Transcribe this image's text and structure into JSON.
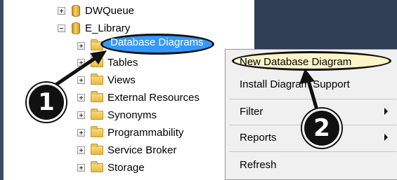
{
  "tree": {
    "items": [
      {
        "label": "DWQueue",
        "type": "database",
        "expander": "plus"
      },
      {
        "label": "E_Library",
        "type": "database",
        "expander": "minus"
      },
      {
        "label": "Database Diagrams",
        "type": "folder",
        "expander": "plus",
        "selected": true
      },
      {
        "label": "Tables",
        "type": "folder",
        "expander": "plus"
      },
      {
        "label": "Views",
        "type": "folder",
        "expander": "plus"
      },
      {
        "label": "External Resources",
        "type": "folder",
        "expander": "plus"
      },
      {
        "label": "Synonyms",
        "type": "folder",
        "expander": "plus"
      },
      {
        "label": "Programmability",
        "type": "folder",
        "expander": "plus"
      },
      {
        "label": "Service Broker",
        "type": "folder",
        "expander": "plus"
      },
      {
        "label": "Storage",
        "type": "folder",
        "expander": "plus"
      }
    ]
  },
  "context_menu": {
    "items": [
      {
        "label": "New Database Diagram",
        "highlighted": true,
        "submenu": false
      },
      {
        "label": "Install Diagram Support",
        "submenu": false
      },
      {
        "label": "Filter",
        "submenu": true
      },
      {
        "label": "Reports",
        "submenu": true
      },
      {
        "label": "Refresh",
        "submenu": false
      }
    ]
  },
  "callouts": {
    "one": "1",
    "two": "2"
  },
  "colors": {
    "selection": "#3399ff",
    "menu_bg": "#f0f0f0",
    "dark_panel": "#2f3d55"
  }
}
